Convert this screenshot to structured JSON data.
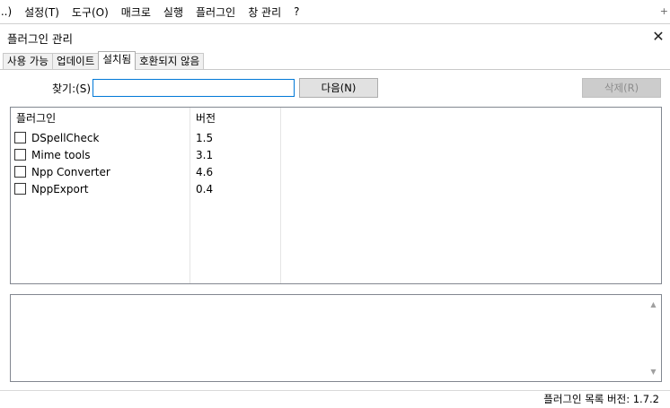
{
  "menubar": {
    "items": [
      "...)",
      "설정(T)",
      "도구(O)",
      "매크로",
      "실행",
      "플러그인",
      "창 관리",
      "?"
    ],
    "overflow": "+"
  },
  "dialog": {
    "title": "플러그인 관리",
    "close_icon": "close-icon"
  },
  "tabs": [
    {
      "label": "사용 가능",
      "active": false
    },
    {
      "label": "업데이트",
      "active": false
    },
    {
      "label": "설치됨",
      "active": true
    },
    {
      "label": "호환되지 않음",
      "active": false
    }
  ],
  "search": {
    "label": "찾기:(S)",
    "value": "",
    "next_button": "다음(N)",
    "remove_button": "삭제(R)"
  },
  "list": {
    "headers": {
      "name": "플러그인",
      "version": "버전"
    },
    "rows": [
      {
        "name": "DSpellCheck",
        "version": "1.5",
        "checked": false
      },
      {
        "name": "Mime tools",
        "version": "3.1",
        "checked": false
      },
      {
        "name": "Npp Converter",
        "version": "4.6",
        "checked": false
      },
      {
        "name": "NppExport",
        "version": "0.4",
        "checked": false
      }
    ]
  },
  "description": {
    "text": ""
  },
  "status": {
    "text": "플러그인 목록 버전: 1.7.2"
  }
}
